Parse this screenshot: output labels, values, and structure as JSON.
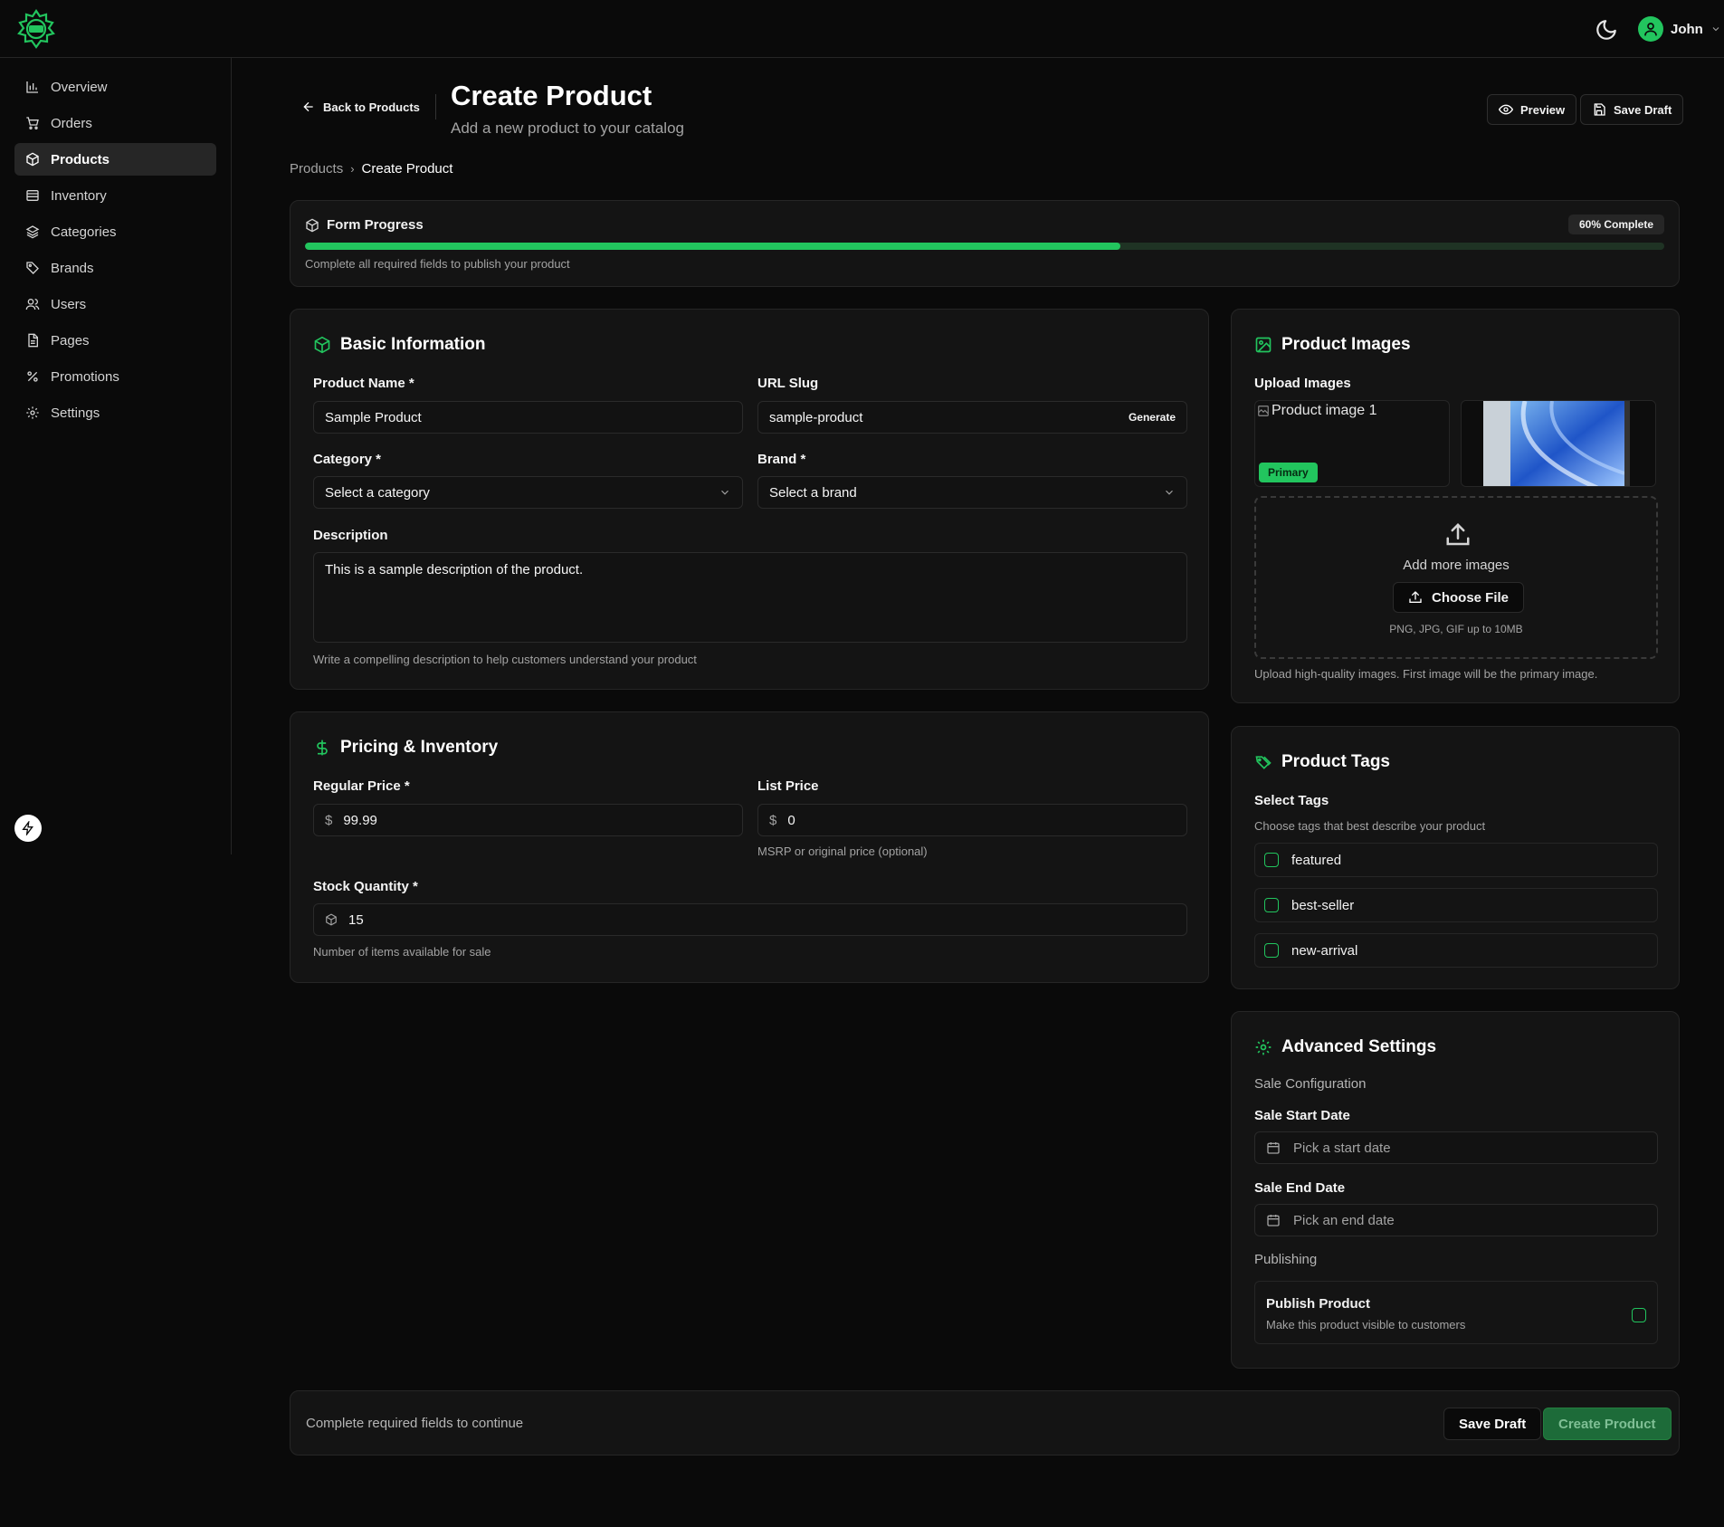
{
  "header": {
    "user_name": "John",
    "theme_icon": "moon-icon",
    "colors": {
      "accent": "#22c55e",
      "background": "#0a0a0a",
      "card": "#141414"
    }
  },
  "sidebar": {
    "items": [
      {
        "label": "Overview",
        "icon": "bar-chart-icon"
      },
      {
        "label": "Orders",
        "icon": "cart-icon"
      },
      {
        "label": "Products",
        "icon": "box-icon",
        "active": true
      },
      {
        "label": "Inventory",
        "icon": "database-icon"
      },
      {
        "label": "Categories",
        "icon": "layers-icon"
      },
      {
        "label": "Brands",
        "icon": "tag-icon"
      },
      {
        "label": "Users",
        "icon": "users-icon"
      },
      {
        "label": "Pages",
        "icon": "file-icon"
      },
      {
        "label": "Promotions",
        "icon": "percent-icon"
      },
      {
        "label": "Settings",
        "icon": "gear-icon"
      }
    ]
  },
  "page": {
    "back_label": "Back to Products",
    "title": "Create Product",
    "subtitle": "Add a new product to your catalog",
    "preview_label": "Preview",
    "save_draft_label": "Save Draft",
    "breadcrumb": {
      "parent": "Products",
      "separator": "›",
      "current": "Create Product"
    }
  },
  "progress": {
    "title": "Form Progress",
    "percent": 60,
    "badge": "60% Complete",
    "hint": "Complete all required fields to publish your product"
  },
  "basic": {
    "title": "Basic Information",
    "name_label": "Product Name *",
    "name_value": "Sample Product",
    "slug_label": "URL Slug",
    "slug_value": "sample-product",
    "generate_label": "Generate",
    "category_label": "Category *",
    "category_placeholder": "Select a category",
    "brand_label": "Brand *",
    "brand_placeholder": "Select a brand",
    "description_label": "Description",
    "description_value": "This is a sample description of the product.",
    "description_hint": "Write a compelling description to help customers understand your product"
  },
  "pricing": {
    "title": "Pricing & Inventory",
    "regular_label": "Regular Price *",
    "currency": "$",
    "regular_value": "99.99",
    "list_label": "List Price",
    "list_value": "0",
    "list_hint": "MSRP or original price (optional)",
    "stock_label": "Stock Quantity *",
    "stock_value": "15",
    "stock_hint": "Number of items available for sale"
  },
  "images": {
    "title": "Product Images",
    "upload_label": "Upload Images",
    "image1_alt": "Product image 1",
    "primary_badge": "Primary",
    "add_more": "Add more images",
    "choose_file": "Choose File",
    "formats": "PNG, JPG, GIF up to 10MB",
    "hint": "Upload high-quality images. First image will be the primary image."
  },
  "tags": {
    "title": "Product Tags",
    "select_label": "Select Tags",
    "hint": "Choose tags that best describe your product",
    "items": [
      "featured",
      "best-seller",
      "new-arrival"
    ]
  },
  "advanced": {
    "title": "Advanced Settings",
    "sale_config": "Sale Configuration",
    "start_label": "Sale Start Date",
    "start_placeholder": "Pick a start date",
    "end_label": "Sale End Date",
    "end_placeholder": "Pick an end date",
    "publishing": "Publishing",
    "publish_title": "Publish Product",
    "publish_desc": "Make this product visible to customers"
  },
  "footer": {
    "status": "Complete required fields to continue",
    "save_draft": "Save Draft",
    "create": "Create Product"
  }
}
